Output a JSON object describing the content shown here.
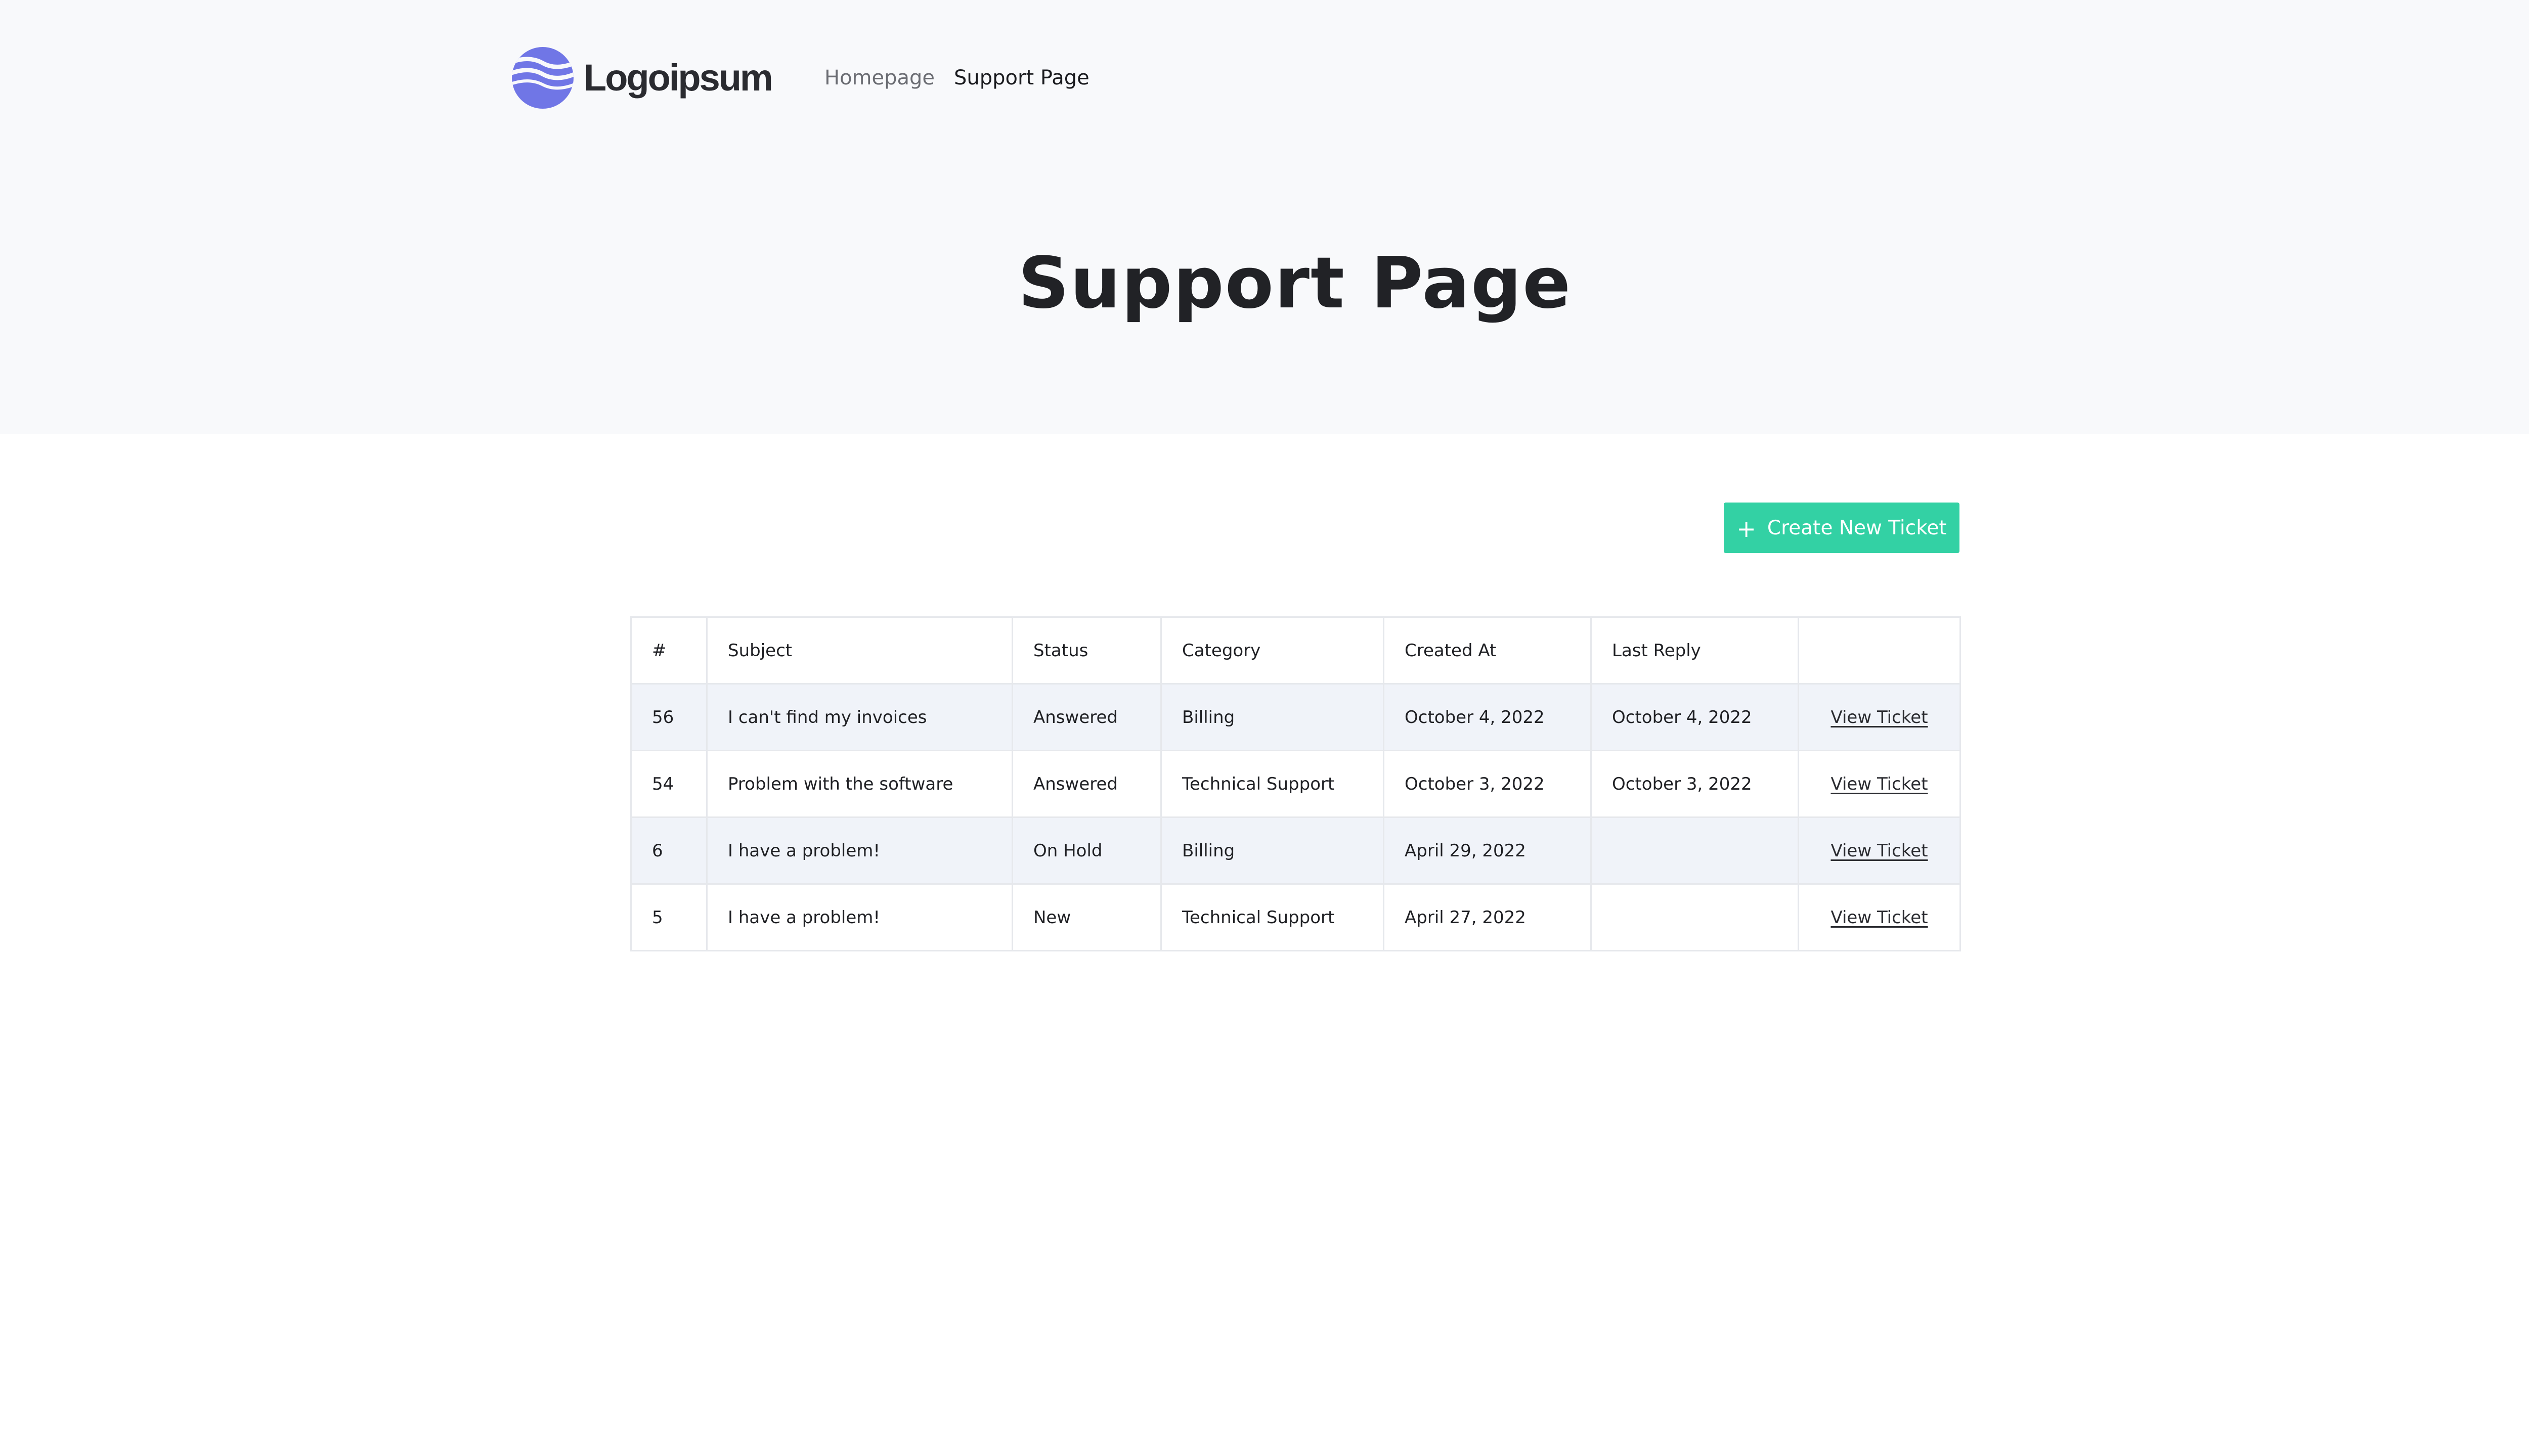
{
  "header": {
    "logo_text": "Logoipsum",
    "nav": [
      {
        "label": "Homepage",
        "active": false
      },
      {
        "label": "Support Page",
        "active": true
      }
    ]
  },
  "page": {
    "title": "Support Page",
    "create_button_label": "Create New Ticket"
  },
  "colors": {
    "brand_icon": "#7076e6",
    "accent_button": "#33d1a4",
    "hero_background": "#f8f9fb",
    "stripe_row": "#f0f3f9"
  },
  "tickets_table": {
    "columns": [
      "#",
      "Subject",
      "Status",
      "Category",
      "Created At",
      "Last Reply",
      ""
    ],
    "rows": [
      {
        "id": "56",
        "subject": "I can't find my invoices",
        "status": "Answered",
        "category": "Billing",
        "created_at": "October 4, 2022",
        "last_reply": "October 4, 2022",
        "action": "View Ticket"
      },
      {
        "id": "54",
        "subject": "Problem with the software",
        "status": "Answered",
        "category": "Technical Support",
        "created_at": "October 3, 2022",
        "last_reply": "October 3, 2022",
        "action": "View Ticket"
      },
      {
        "id": "6",
        "subject": "I have a problem!",
        "status": "On Hold",
        "category": "Billing",
        "created_at": "April 29, 2022",
        "last_reply": "",
        "action": "View Ticket"
      },
      {
        "id": "5",
        "subject": "I have a problem!",
        "status": "New",
        "category": "Technical Support",
        "created_at": "April 27, 2022",
        "last_reply": "",
        "action": "View Ticket"
      }
    ]
  }
}
